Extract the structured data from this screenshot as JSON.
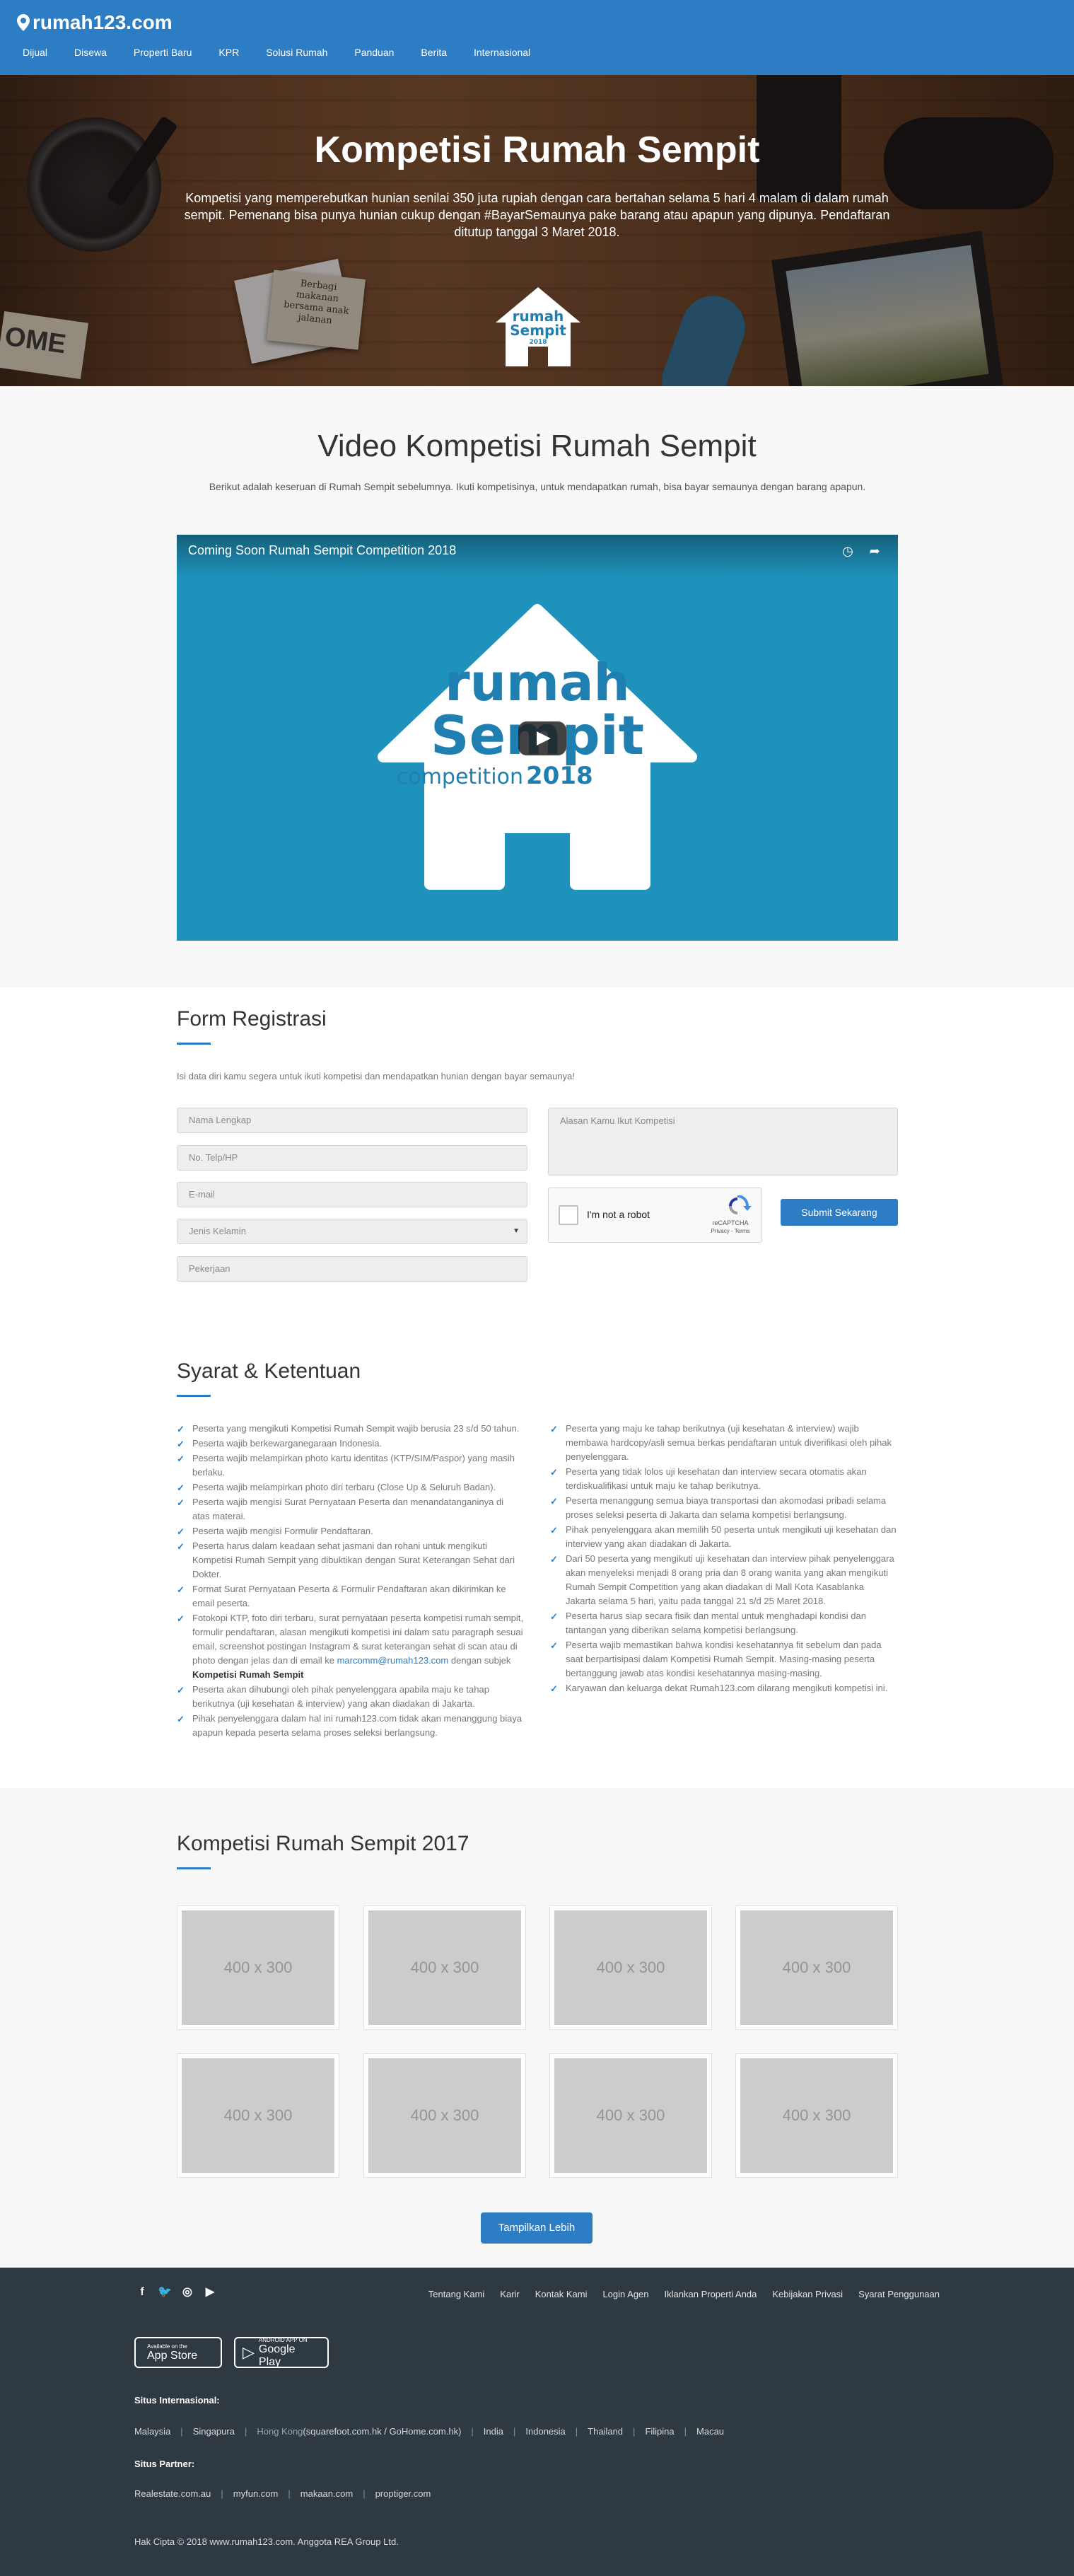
{
  "header": {
    "logo": "rumah123.com",
    "nav": [
      "Dijual",
      "Disewa",
      "Properti Baru",
      "KPR",
      "Solusi Rumah",
      "Panduan",
      "Berita",
      "Internasional"
    ]
  },
  "hero": {
    "title": "Kompetisi Rumah Sempit",
    "description": "Kompetisi yang memperebutkan hunian senilai 350 juta rupiah dengan cara bertahan selama 5 hari 4 malam di dalam rumah sempit. Pemenang bisa punya hunian cukup dengan #BayarSemaunya pake barang atau apapun yang dipunya. Pendaftaran ditutup tanggal 3 Maret 2018.",
    "photo_card_text": "Berbagi makanan bersama anak jalanan",
    "sign_text": "OME",
    "logo_text_top": "rumah",
    "logo_text_mid": "Sempit",
    "logo_text_bottom": "2018"
  },
  "video_section": {
    "title": "Video Kompetisi Rumah Sempit",
    "description": "Berikut adalah keseruan di Rumah Sempit sebelumnya. Ikuti kompetisinya, untuk mendapatkan rumah, bisa bayar semaunya dengan barang apapun.",
    "video_caption": "Coming Soon Rumah Sempit Competition 2018",
    "video_logo_top": "rumah",
    "video_logo_mid": "Sempit",
    "video_logo_bottom_a": "competition",
    "video_logo_bottom_b": "2018"
  },
  "form": {
    "title": "Form Registrasi",
    "description": "Isi data diri kamu segera untuk ikuti kompetisi dan mendapatkan hunian dengan bayar semaunya!",
    "fields": {
      "name": "Nama Lengkap",
      "phone": "No. Telp/HP",
      "email": "E-mail",
      "gender": "Jenis Kelamin",
      "job": "Pekerjaan",
      "reason": "Alasan Kamu Ikut Kompetisi"
    },
    "captcha": {
      "label": "I'm not a robot",
      "brand": "reCAPTCHA",
      "links": "Privacy - Terms"
    },
    "submit": "Submit Sekarang"
  },
  "terms": {
    "title": "Syarat & Ketentuan",
    "left": [
      "Peserta yang mengikuti Kompetisi Rumah Sempit wajib berusia 23 s/d 50 tahun.",
      "Peserta wajib berkewarganegaraan Indonesia.",
      "Peserta wajib melampirkan photo kartu identitas (KTP/SIM/Paspor) yang masih berlaku.",
      "Peserta wajib melampirkan photo diri terbaru (Close Up & Seluruh Badan).",
      "Peserta wajib mengisi Surat Pernyataan Peserta dan menandatanganinya di atas materai.",
      "Peserta wajib mengisi Formulir Pendaftaran.",
      "Peserta harus dalam keadaan sehat jasmani dan rohani untuk mengikuti Kompetisi Rumah Sempit yang dibuktikan dengan Surat Keterangan Sehat dari Dokter.",
      "Format Surat Pernyataan Peserta & Formulir Pendaftaran akan dikirimkan ke email peserta."
    ],
    "left_fotokopi_a": "Fotokopi KTP, foto diri terbaru, surat pernyataan peserta kompetisi rumah sempit, formulir pendaftaran, alasan mengikuti kompetisi ini dalam satu paragraph sesuai email, screenshot postingan Instagram & surat keterangan sehat di scan atau di photo dengan jelas dan di email ke",
    "left_fotokopi_email": "marcomm@rumah123.com",
    "left_fotokopi_b": " dengan subjek ",
    "left_fotokopi_subject": "Kompetisi Rumah Sempit",
    "left_tail": [
      "Peserta akan dihubungi oleh pihak penyelenggara apabila maju ke tahap berikutnya (uji kesehatan & interview) yang akan diadakan di Jakarta.",
      "Pihak penyelenggara dalam hal ini rumah123.com tidak akan menanggung biaya apapun kepada peserta selama proses seleksi berlangsung."
    ],
    "right": [
      "Peserta yang maju ke tahap berikutnya (uji kesehatan & interview) wajib membawa hardcopy/asli semua berkas pendaftaran untuk diverifikasi oleh pihak penyelenggara.",
      "Peserta yang tidak lolos uji kesehatan dan interview secara otomatis akan terdiskualifikasi untuk maju ke tahap berikutnya.",
      "Peserta menanggung semua biaya transportasi dan akomodasi pribadi selama proses seleksi peserta di Jakarta dan selama kompetisi berlangsung.",
      "Pihak penyelenggara akan memilih 50 peserta untuk mengikuti uji kesehatan dan interview yang akan diadakan di Jakarta.",
      "Dari 50 peserta yang mengikuti uji kesehatan dan interview pihak penyelenggara akan menyeleksi menjadi 8 orang pria dan 8 orang wanita yang akan mengikuti Rumah Sempit Competition yang akan diadakan di Mall Kota Kasablanka Jakarta selama 5 hari, yaitu pada tanggal 21 s/d 25 Maret 2018.",
      "Peserta harus siap secara fisik dan mental untuk menghadapi kondisi dan tantangan yang diberikan selama kompetisi berlangsung.",
      "Peserta wajib memastikan bahwa kondisi kesehatannya fit sebelum dan pada saat berpartisipasi dalam Kompetisi Rumah Sempit. Masing-masing peserta bertanggung jawab atas kondisi kesehatannya masing-masing.",
      "Karyawan dan keluarga dekat Rumah123.com dilarang mengikuti kompetisi ini."
    ]
  },
  "gallery": {
    "title": "Kompetisi Rumah Sempit 2017",
    "placeholder": "400 x 300",
    "more": "Tampilkan Lebih"
  },
  "footer": {
    "social": [
      "facebook-icon",
      "twitter-icon",
      "instagram-icon",
      "youtube-icon"
    ],
    "links": [
      "Tentang Kami",
      "Karir",
      "Kontak Kami",
      "Login Agen",
      "Iklankan Properti Anda",
      "Kebijakan Privasi",
      "Syarat Penggunaan"
    ],
    "appstore_small": "Available on the",
    "appstore_big": "App Store",
    "googleplay_small": "ANDROID APP ON",
    "googleplay_big": "Google Play",
    "intl_label": "Situs Internasional:",
    "intl": {
      "malaysia": "Malaysia",
      "singapura": "Singapura",
      "hongkong": "Hong Kong",
      "hongkong_sites": " (squarefoot.com.hk / GoHome.com.hk)",
      "india": "India",
      "indonesia": "Indonesia",
      "thailand": "Thailand",
      "filipina": "Filipina",
      "macau": "Macau"
    },
    "partner_label": "Situs Partner:",
    "partners": [
      "Realestate.com.au",
      "myfun.com",
      "makaan.com",
      "proptiger.com"
    ],
    "copyright": "Hak Cipta © 2018 www.rumah123.com. Anggota REA Group Ltd."
  }
}
